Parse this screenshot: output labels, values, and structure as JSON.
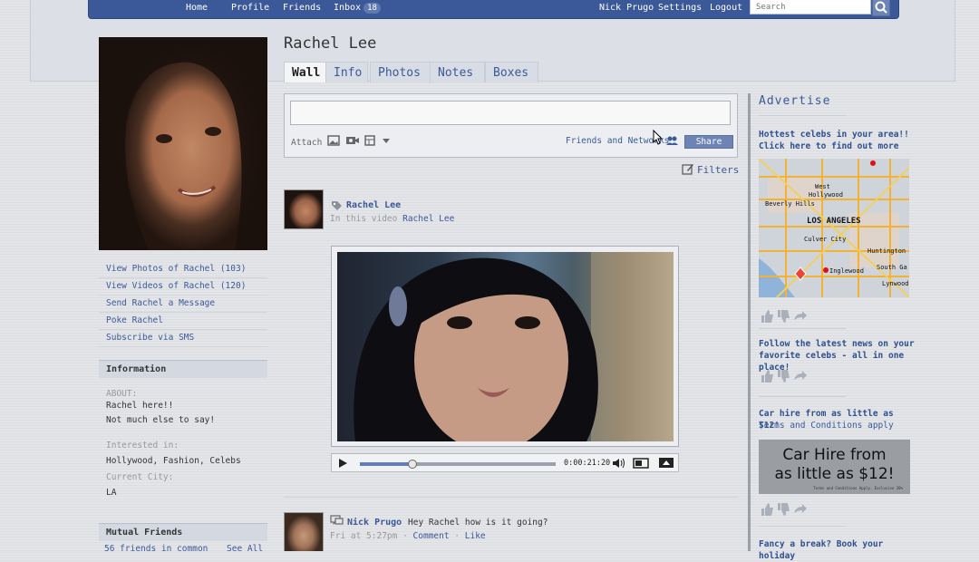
{
  "nav": {
    "home": "Home",
    "profile": "Profile",
    "friends": "Friends",
    "inbox": "Inbox",
    "inbox_count": "18",
    "user_name": "Nick Prugo",
    "settings": "Settings",
    "logout": "Logout",
    "search_placeholder": "Search"
  },
  "profile": {
    "name": "Rachel Lee",
    "links": [
      "View Photos of Rachel (103)",
      "View Videos of Rachel (120)",
      "Send Rachel a Message",
      "Poke Rachel",
      "Subscribe via SMS"
    ]
  },
  "information": {
    "header": "Information",
    "about_label": "ABOUT:",
    "about_line1": "Rachel here!!",
    "about_line2": "Not much else to say!",
    "interested_label": "Interested in:",
    "interested_value": "Hollywood, Fashion, Celebs",
    "city_label": "Current City:",
    "city_value": "LA"
  },
  "mutual": {
    "header": "Mutual Friends",
    "count_text": "56 friends in common",
    "see_all": "See All"
  },
  "tabs": [
    "Wall",
    "Info",
    "Photos",
    "Notes",
    "Boxes"
  ],
  "composer": {
    "attach_label": "Attach",
    "audience": "Friends and Networks",
    "share": "Share"
  },
  "filters": "Filters",
  "story": {
    "author": "Rachel Lee",
    "sub_prefix": "In this video",
    "sub_link": "Rachel Lee",
    "time_code": "0:00:21:20",
    "progress": 0.27
  },
  "post": {
    "author": "Nick Prugo",
    "text": "Hey Rachel how is it going?",
    "time": "Fri at 5:27pm",
    "comment": "Comment",
    "like": "Like"
  },
  "ads": {
    "title": "Advertise",
    "ad1_line1": "Hottest celebs in your area!!",
    "ad1_line2": "Click here to find out more",
    "map_labels": [
      "West",
      "Hollywood",
      "Beverly Hills",
      "LOS ANGELES",
      "Culver City",
      "Huntington",
      "Inglewood",
      "South Ga",
      "Lynwood"
    ],
    "ad2_line1": "Follow the latest news on your",
    "ad2_line2": "favorite celebs - all in one place!",
    "ad3_head": "Car hire from as little as $12!",
    "ad3_sub": "Terms and Conditions apply",
    "car_line1": "Car Hire from",
    "car_line2": "as little as $12!",
    "car_fine": "Terms and Conditions Apply. Exclusive 20%",
    "ad4_head": "Fancy a break? Book your holiday"
  }
}
